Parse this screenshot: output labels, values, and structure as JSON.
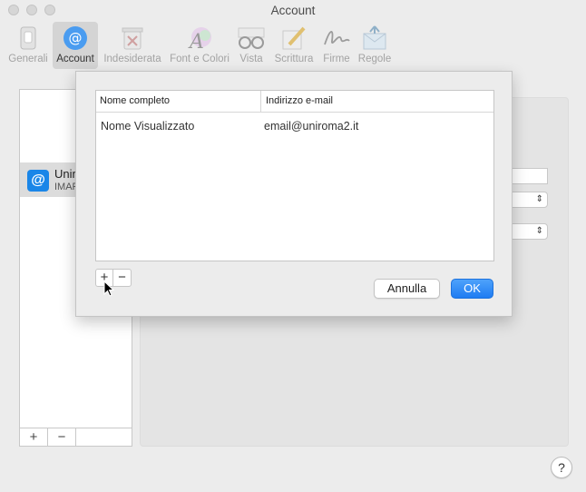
{
  "window": {
    "title": "Account"
  },
  "toolbar": {
    "items": [
      {
        "label": "Generali",
        "icon": "switch-icon"
      },
      {
        "label": "Account",
        "icon": "at-icon"
      },
      {
        "label": "Indesiderata",
        "icon": "junk-icon"
      },
      {
        "label": "Font e Colori",
        "icon": "font-colors-icon"
      },
      {
        "label": "Vista",
        "icon": "glasses-icon"
      },
      {
        "label": "Scrittura",
        "icon": "pencil-icon"
      },
      {
        "label": "Firme",
        "icon": "signature-icon"
      },
      {
        "label": "Regole",
        "icon": "rules-icon"
      }
    ]
  },
  "accounts": {
    "items": [
      {
        "name": "Unir",
        "type": "IMAP",
        "avatar": "@"
      }
    ],
    "add_label": "+",
    "remove_label": "−"
  },
  "sheet": {
    "columns": [
      "Nome completo",
      "Indirizzo e-mail"
    ],
    "rows": [
      [
        "Nome Visualizzato",
        "email@uniroma2.it"
      ]
    ],
    "add_label": "+",
    "remove_label": "−",
    "cancel_label": "Annulla",
    "ok_label": "OK"
  },
  "help": {
    "label": "?"
  },
  "colors": {
    "accent": "#1f7cf2",
    "avatar": "#1a86e8"
  }
}
